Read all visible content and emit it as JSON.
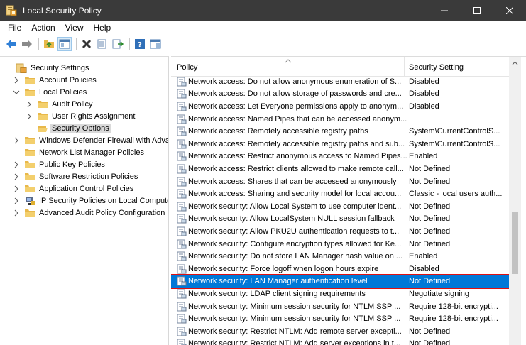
{
  "window": {
    "title": "Local Security Policy"
  },
  "menu": [
    "File",
    "Action",
    "View",
    "Help"
  ],
  "tree": [
    {
      "label": "Security Settings",
      "level": 0,
      "expander": "",
      "icon": "shield"
    },
    {
      "label": "Account Policies",
      "level": 1,
      "expander": ">",
      "icon": "folder"
    },
    {
      "label": "Local Policies",
      "level": 1,
      "expander": "v",
      "icon": "folder"
    },
    {
      "label": "Audit Policy",
      "level": 2,
      "expander": ">",
      "icon": "folder"
    },
    {
      "label": "User Rights Assignment",
      "level": 2,
      "expander": ">",
      "icon": "folder"
    },
    {
      "label": "Security Options",
      "level": 2,
      "expander": "",
      "icon": "folder-open",
      "selected": true
    },
    {
      "label": "Windows Defender Firewall with Adva",
      "level": 1,
      "expander": ">",
      "icon": "folder"
    },
    {
      "label": "Network List Manager Policies",
      "level": 1,
      "expander": "",
      "icon": "folder"
    },
    {
      "label": "Public Key Policies",
      "level": 1,
      "expander": ">",
      "icon": "folder"
    },
    {
      "label": "Software Restriction Policies",
      "level": 1,
      "expander": ">",
      "icon": "folder"
    },
    {
      "label": "Application Control Policies",
      "level": 1,
      "expander": ">",
      "icon": "folder"
    },
    {
      "label": "IP Security Policies on Local Compute",
      "level": 1,
      "expander": ">",
      "icon": "ipsec"
    },
    {
      "label": "Advanced Audit Policy Configuration",
      "level": 1,
      "expander": ">",
      "icon": "folder"
    }
  ],
  "table": {
    "col_policy": "Policy",
    "col_setting": "Security Setting",
    "rows": [
      {
        "policy": "Network access: Do not allow anonymous enumeration of S...",
        "setting": "Disabled"
      },
      {
        "policy": "Network access: Do not allow storage of passwords and cre...",
        "setting": "Disabled"
      },
      {
        "policy": "Network access: Let Everyone permissions apply to anonym...",
        "setting": "Disabled"
      },
      {
        "policy": "Network access: Named Pipes that can be accessed anonym...",
        "setting": ""
      },
      {
        "policy": "Network access: Remotely accessible registry paths",
        "setting": "System\\CurrentControlS..."
      },
      {
        "policy": "Network access: Remotely accessible registry paths and sub...",
        "setting": "System\\CurrentControlS..."
      },
      {
        "policy": "Network access: Restrict anonymous access to Named Pipes...",
        "setting": "Enabled"
      },
      {
        "policy": "Network access: Restrict clients allowed to make remote call...",
        "setting": "Not Defined"
      },
      {
        "policy": "Network access: Shares that can be accessed anonymously",
        "setting": "Not Defined"
      },
      {
        "policy": "Network access: Sharing and security model for local accou...",
        "setting": "Classic - local users auth..."
      },
      {
        "policy": "Network security: Allow Local System to use computer ident...",
        "setting": "Not Defined"
      },
      {
        "policy": "Network security: Allow LocalSystem NULL session fallback",
        "setting": "Not Defined"
      },
      {
        "policy": "Network security: Allow PKU2U authentication requests to t...",
        "setting": "Not Defined"
      },
      {
        "policy": "Network security: Configure encryption types allowed for Ke...",
        "setting": "Not Defined"
      },
      {
        "policy": "Network security: Do not store LAN Manager hash value on ...",
        "setting": "Enabled"
      },
      {
        "policy": "Network security: Force logoff when logon hours expire",
        "setting": "Disabled"
      },
      {
        "policy": "Network security: LAN Manager authentication level",
        "setting": "Not Defined",
        "selected": true
      },
      {
        "policy": "Network security: LDAP client signing requirements",
        "setting": "Negotiate signing"
      },
      {
        "policy": "Network security: Minimum session security for NTLM SSP ...",
        "setting": "Require 128-bit encrypti..."
      },
      {
        "policy": "Network security: Minimum session security for NTLM SSP ...",
        "setting": "Require 128-bit encrypti..."
      },
      {
        "policy": "Network security: Restrict NTLM: Add remote server excepti...",
        "setting": "Not Defined"
      },
      {
        "policy": "Network security: Restrict NTLM: Add server exceptions in t...",
        "setting": "Not Defined"
      }
    ]
  },
  "colors": {
    "titlebar": "#3a3a3a",
    "selection": "#0078d7",
    "highlight_border": "#e01010",
    "folder": "#e8b84a"
  }
}
